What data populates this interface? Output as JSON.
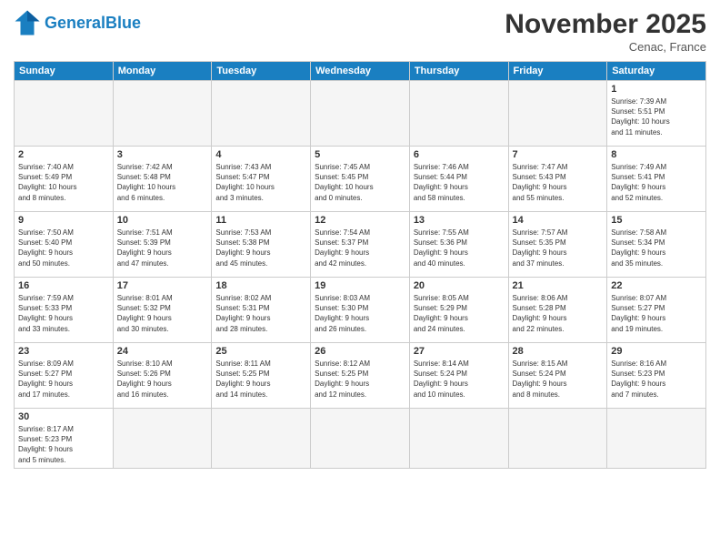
{
  "logo": {
    "text_general": "General",
    "text_blue": "Blue"
  },
  "header": {
    "month": "November 2025",
    "location": "Cenac, France"
  },
  "weekdays": [
    "Sunday",
    "Monday",
    "Tuesday",
    "Wednesday",
    "Thursday",
    "Friday",
    "Saturday"
  ],
  "weeks": [
    [
      {
        "day": "",
        "info": ""
      },
      {
        "day": "",
        "info": ""
      },
      {
        "day": "",
        "info": ""
      },
      {
        "day": "",
        "info": ""
      },
      {
        "day": "",
        "info": ""
      },
      {
        "day": "",
        "info": ""
      },
      {
        "day": "1",
        "info": "Sunrise: 7:39 AM\nSunset: 5:51 PM\nDaylight: 10 hours\nand 11 minutes."
      }
    ],
    [
      {
        "day": "2",
        "info": "Sunrise: 7:40 AM\nSunset: 5:49 PM\nDaylight: 10 hours\nand 8 minutes."
      },
      {
        "day": "3",
        "info": "Sunrise: 7:42 AM\nSunset: 5:48 PM\nDaylight: 10 hours\nand 6 minutes."
      },
      {
        "day": "4",
        "info": "Sunrise: 7:43 AM\nSunset: 5:47 PM\nDaylight: 10 hours\nand 3 minutes."
      },
      {
        "day": "5",
        "info": "Sunrise: 7:45 AM\nSunset: 5:45 PM\nDaylight: 10 hours\nand 0 minutes."
      },
      {
        "day": "6",
        "info": "Sunrise: 7:46 AM\nSunset: 5:44 PM\nDaylight: 9 hours\nand 58 minutes."
      },
      {
        "day": "7",
        "info": "Sunrise: 7:47 AM\nSunset: 5:43 PM\nDaylight: 9 hours\nand 55 minutes."
      },
      {
        "day": "8",
        "info": "Sunrise: 7:49 AM\nSunset: 5:41 PM\nDaylight: 9 hours\nand 52 minutes."
      }
    ],
    [
      {
        "day": "9",
        "info": "Sunrise: 7:50 AM\nSunset: 5:40 PM\nDaylight: 9 hours\nand 50 minutes."
      },
      {
        "day": "10",
        "info": "Sunrise: 7:51 AM\nSunset: 5:39 PM\nDaylight: 9 hours\nand 47 minutes."
      },
      {
        "day": "11",
        "info": "Sunrise: 7:53 AM\nSunset: 5:38 PM\nDaylight: 9 hours\nand 45 minutes."
      },
      {
        "day": "12",
        "info": "Sunrise: 7:54 AM\nSunset: 5:37 PM\nDaylight: 9 hours\nand 42 minutes."
      },
      {
        "day": "13",
        "info": "Sunrise: 7:55 AM\nSunset: 5:36 PM\nDaylight: 9 hours\nand 40 minutes."
      },
      {
        "day": "14",
        "info": "Sunrise: 7:57 AM\nSunset: 5:35 PM\nDaylight: 9 hours\nand 37 minutes."
      },
      {
        "day": "15",
        "info": "Sunrise: 7:58 AM\nSunset: 5:34 PM\nDaylight: 9 hours\nand 35 minutes."
      }
    ],
    [
      {
        "day": "16",
        "info": "Sunrise: 7:59 AM\nSunset: 5:33 PM\nDaylight: 9 hours\nand 33 minutes."
      },
      {
        "day": "17",
        "info": "Sunrise: 8:01 AM\nSunset: 5:32 PM\nDaylight: 9 hours\nand 30 minutes."
      },
      {
        "day": "18",
        "info": "Sunrise: 8:02 AM\nSunset: 5:31 PM\nDaylight: 9 hours\nand 28 minutes."
      },
      {
        "day": "19",
        "info": "Sunrise: 8:03 AM\nSunset: 5:30 PM\nDaylight: 9 hours\nand 26 minutes."
      },
      {
        "day": "20",
        "info": "Sunrise: 8:05 AM\nSunset: 5:29 PM\nDaylight: 9 hours\nand 24 minutes."
      },
      {
        "day": "21",
        "info": "Sunrise: 8:06 AM\nSunset: 5:28 PM\nDaylight: 9 hours\nand 22 minutes."
      },
      {
        "day": "22",
        "info": "Sunrise: 8:07 AM\nSunset: 5:27 PM\nDaylight: 9 hours\nand 19 minutes."
      }
    ],
    [
      {
        "day": "23",
        "info": "Sunrise: 8:09 AM\nSunset: 5:27 PM\nDaylight: 9 hours\nand 17 minutes."
      },
      {
        "day": "24",
        "info": "Sunrise: 8:10 AM\nSunset: 5:26 PM\nDaylight: 9 hours\nand 16 minutes."
      },
      {
        "day": "25",
        "info": "Sunrise: 8:11 AM\nSunset: 5:25 PM\nDaylight: 9 hours\nand 14 minutes."
      },
      {
        "day": "26",
        "info": "Sunrise: 8:12 AM\nSunset: 5:25 PM\nDaylight: 9 hours\nand 12 minutes."
      },
      {
        "day": "27",
        "info": "Sunrise: 8:14 AM\nSunset: 5:24 PM\nDaylight: 9 hours\nand 10 minutes."
      },
      {
        "day": "28",
        "info": "Sunrise: 8:15 AM\nSunset: 5:24 PM\nDaylight: 9 hours\nand 8 minutes."
      },
      {
        "day": "29",
        "info": "Sunrise: 8:16 AM\nSunset: 5:23 PM\nDaylight: 9 hours\nand 7 minutes."
      }
    ],
    [
      {
        "day": "30",
        "info": "Sunrise: 8:17 AM\nSunset: 5:23 PM\nDaylight: 9 hours\nand 5 minutes."
      },
      {
        "day": "",
        "info": ""
      },
      {
        "day": "",
        "info": ""
      },
      {
        "day": "",
        "info": ""
      },
      {
        "day": "",
        "info": ""
      },
      {
        "day": "",
        "info": ""
      },
      {
        "day": "",
        "info": ""
      }
    ]
  ]
}
